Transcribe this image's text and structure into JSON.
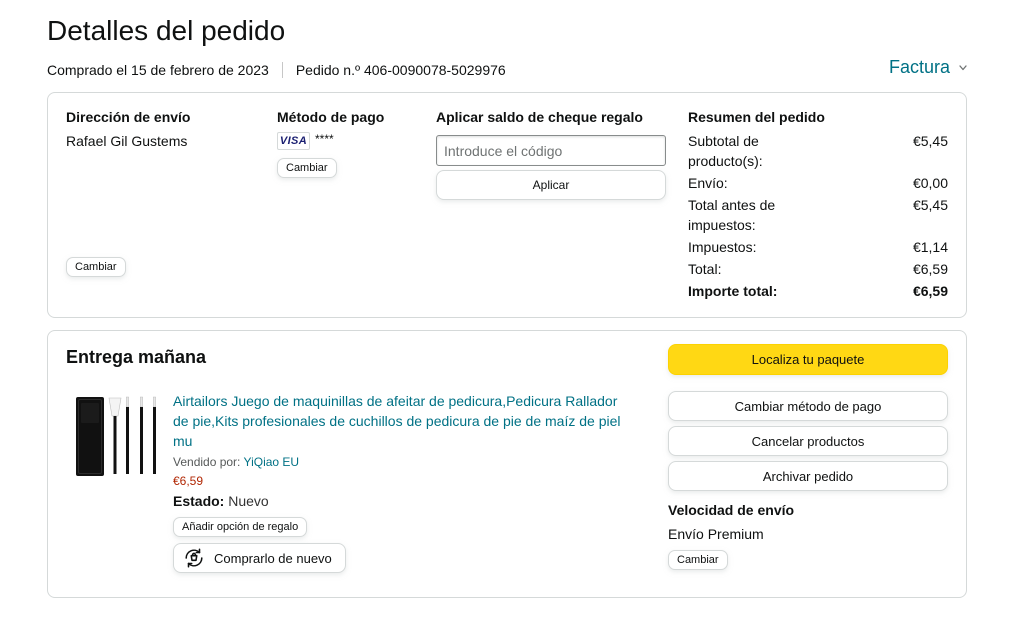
{
  "theme": {
    "text": "#0F1111",
    "link": "#007185",
    "price": "#B12704",
    "muted": "#565959",
    "border": "#D5D9D9",
    "primary_button": "#FFD814",
    "primary_button_border": "#FCD200",
    "visa_blue": "#1A1F71"
  },
  "icons": {
    "invoice_dropdown": "chevron-down-icon",
    "buy_again": "buy-again-icon",
    "payment_card": "visa-logo"
  },
  "page": {
    "title": "Detalles del pedido",
    "purchase_date": "Comprado el 15 de febrero de 2023",
    "order_number": "Pedido n.º 406-0090078-5029976",
    "invoice_label": "Factura"
  },
  "shipping_address": {
    "heading": "Dirección de envío",
    "name": "Rafael Gil Gustems",
    "change_label": "Cambiar"
  },
  "payment_method": {
    "heading": "Método de pago",
    "card_brand": "VISA",
    "card_number_mask": "****",
    "change_label": "Cambiar"
  },
  "gift_card": {
    "heading": "Aplicar saldo de cheque regalo",
    "input_placeholder": "Introduce el código",
    "input_value": "",
    "apply_label": "Aplicar"
  },
  "order_summary": {
    "heading": "Resumen del pedido",
    "rows": [
      {
        "label": "Subtotal de producto(s):",
        "value": "€5,45"
      },
      {
        "label": "Envío:",
        "value": "€0,00"
      },
      {
        "label": "Total antes de impuestos:",
        "value": "€5,45"
      },
      {
        "label": "Impuestos:",
        "value": "€1,14"
      },
      {
        "label": "Total:",
        "value": "€6,59"
      }
    ],
    "grand_total_label": "Importe total:",
    "grand_total_value": "€6,59"
  },
  "shipment": {
    "heading": "Entrega mañana",
    "item": {
      "title": "Airtailors Juego de maquinillas de afeitar de pedicura,Pedicura Rallador de pie,Kits profesionales de cuchillos de pedicura de pie de maíz de piel mu",
      "sold_by_label": "Vendido por:",
      "seller": "YiQiao EU",
      "price": "€6,59",
      "condition_label": "Estado:",
      "condition_value": "Nuevo",
      "gift_option_label": "Añadir opción de regalo",
      "buy_again_label": "Comprarlo de nuevo"
    },
    "actions": {
      "track_package": "Localiza tu paquete",
      "change_payment": "Cambiar método de pago",
      "cancel_items": "Cancelar productos",
      "archive_order": "Archivar pedido"
    },
    "delivery_speed": {
      "heading": "Velocidad de envío",
      "value": "Envío Premium",
      "change_label": "Cambiar"
    }
  }
}
